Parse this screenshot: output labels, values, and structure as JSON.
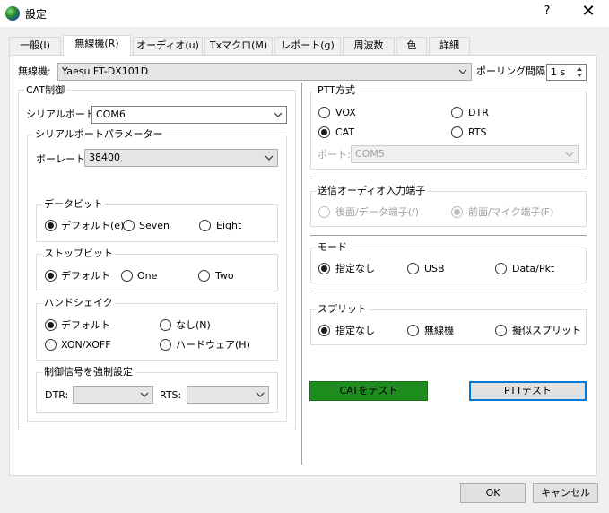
{
  "window": {
    "title": "設定",
    "help": "?",
    "close": "✕"
  },
  "tabs": [
    "一般(I)",
    "無線機(R)",
    "オーディオ(u)",
    "Txマクロ(M)",
    "レポート(g)",
    "周波数",
    "色",
    "詳細"
  ],
  "radio": {
    "label": "無線機:",
    "value": "Yaesu FT-DX101D",
    "polling_label": "ポーリング間隔:",
    "polling_value": "1 s"
  },
  "cat": {
    "title": "CAT制御",
    "serial_port_label": "シリアルポート:",
    "serial_port": "COM6",
    "params_title": "シリアルポートパラメーター",
    "baud_label": "ボーレート:",
    "baud": "38400",
    "databits": {
      "title": "データビット",
      "opt1": "デフォルト(e)",
      "opt2": "Seven",
      "opt3": "Eight"
    },
    "stopbits": {
      "title": "ストップビット",
      "opt1": "デフォルト",
      "opt2": "One",
      "opt3": "Two"
    },
    "handshake": {
      "title": "ハンドシェイク",
      "opt1": "デフォルト",
      "opt2": "なし(N)",
      "opt3": "XON/XOFF",
      "opt4": "ハードウェア(H)"
    },
    "force": {
      "title": "制御信号を強制設定",
      "dtr": "DTR:",
      "rts": "RTS:"
    }
  },
  "ptt": {
    "title": "PTT方式",
    "vox": "VOX",
    "dtr": "DTR",
    "cat": "CAT",
    "rts": "RTS",
    "port_label": "ポート:",
    "port": "COM5"
  },
  "audio_in": {
    "title": "送信オーディオ入力端子",
    "rear": "後面/データ端子(/)",
    "front": "前面/マイク端子(F)"
  },
  "mode": {
    "title": "モード",
    "none": "指定なし",
    "usb": "USB",
    "data": "Data/Pkt"
  },
  "split": {
    "title": "スプリット",
    "none": "指定なし",
    "rig": "無線機",
    "fake": "擬似スプリット"
  },
  "buttons": {
    "test_cat": "CATをテスト",
    "test_ptt": "PTTテスト",
    "ok": "OK",
    "cancel": "キャンセル"
  },
  "colors": {
    "test_cat_bg": "#1e8c1e",
    "focus_border": "#0078d7"
  }
}
